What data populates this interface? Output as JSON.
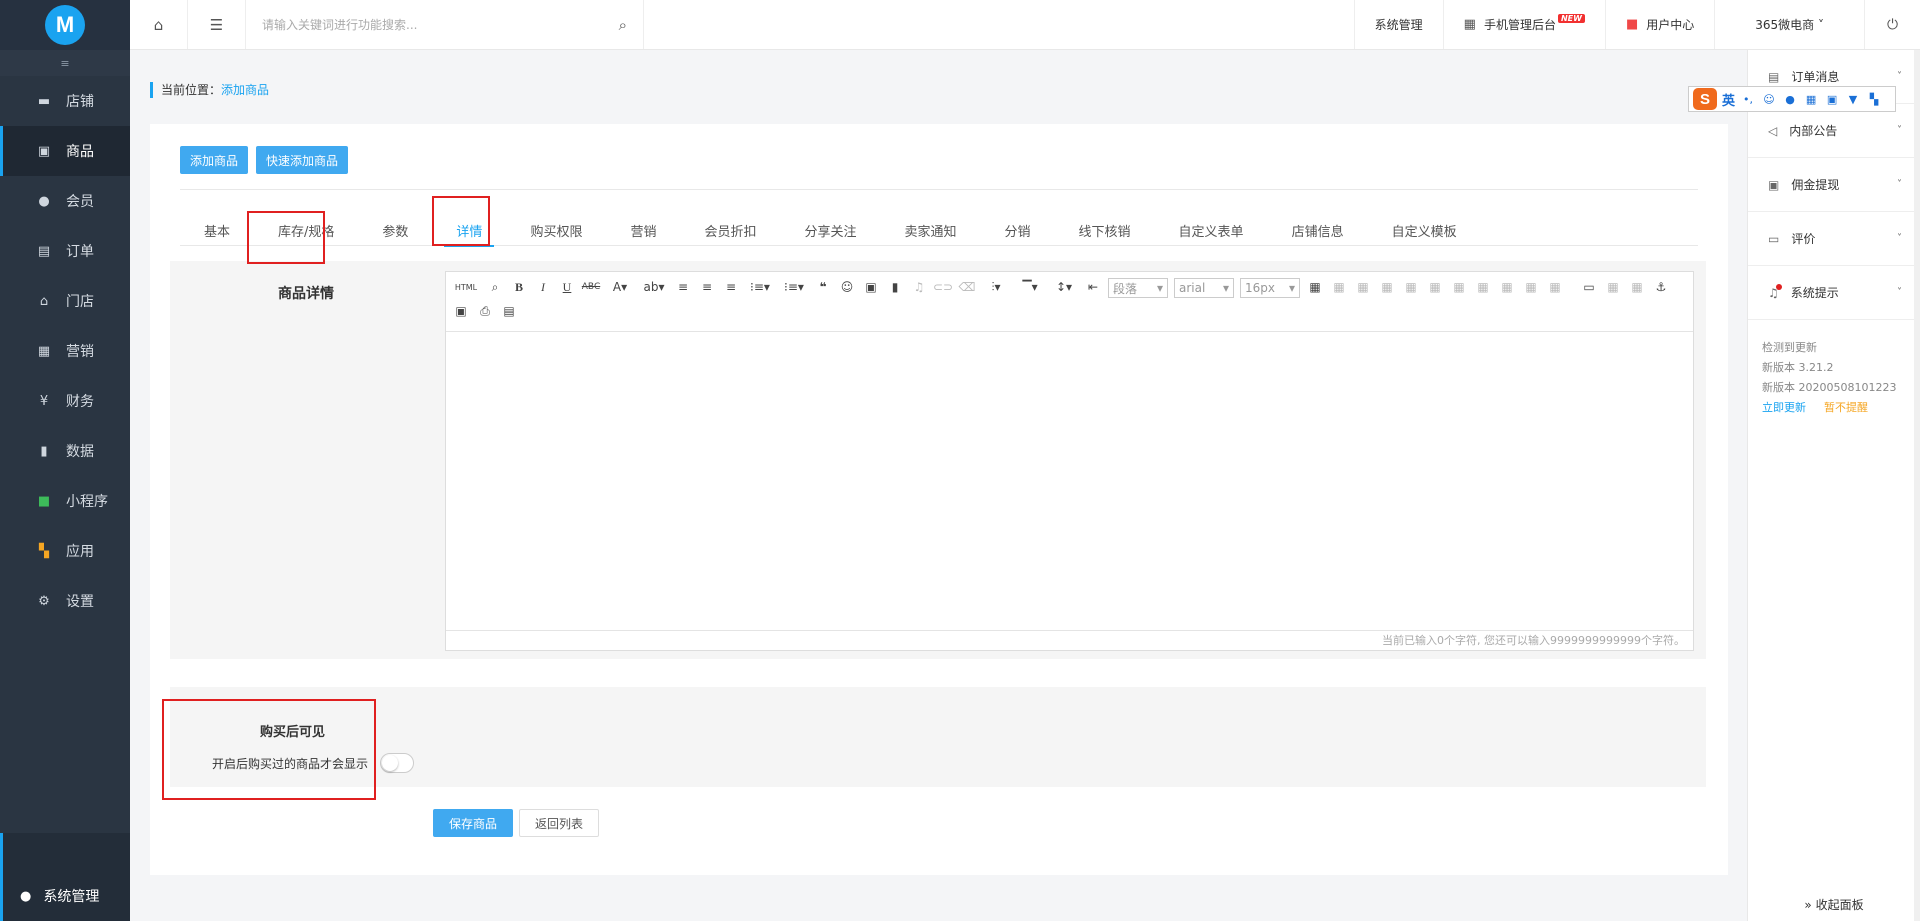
{
  "sidebar": {
    "logo_text": "M",
    "collapse_icon": "≡",
    "items": [
      {
        "label": "店铺",
        "icon": "store-icon"
      },
      {
        "label": "商品",
        "icon": "goods-icon"
      },
      {
        "label": "会员",
        "icon": "member-icon"
      },
      {
        "label": "订单",
        "icon": "order-icon"
      },
      {
        "label": "门店",
        "icon": "shop-icon"
      },
      {
        "label": "营销",
        "icon": "gift-icon"
      },
      {
        "label": "财务",
        "icon": "money-bag-icon"
      },
      {
        "label": "数据",
        "icon": "chart-icon"
      },
      {
        "label": "小程序",
        "icon": "miniapp-icon"
      },
      {
        "label": "应用",
        "icon": "apps-icon"
      },
      {
        "label": "设置",
        "icon": "gear-icon"
      }
    ],
    "active_index": 1,
    "bottom": {
      "label": "系统管理",
      "icon": "user-admin-icon"
    }
  },
  "header": {
    "search_placeholder": "请输入关键词进行功能搜索...",
    "links": {
      "system": "系统管理",
      "mobile": "手机管理后台",
      "new_badge": "NEW",
      "user_center": "用户中心",
      "shop_name": "365微电商 ˅"
    }
  },
  "breadcrumb": {
    "prefix": "当前位置：",
    "current": "添加商品"
  },
  "buttons": {
    "add_goods": "添加商品",
    "quick_add": "快速添加商品",
    "save": "保存商品",
    "back": "返回列表"
  },
  "tabs": [
    "基本",
    "库存/规格",
    "参数",
    "详情",
    "购买权限",
    "营销",
    "会员折扣",
    "分享关注",
    "卖家通知",
    "分销",
    "线下核销",
    "自定义表单",
    "店铺信息",
    "自定义模板"
  ],
  "active_tab": 3,
  "detail": {
    "label": "商品详情",
    "editor": {
      "paragraph": "段落",
      "font": "arial",
      "size": "16px",
      "status": "当前已输入0个字符, 您还可以输入9999999999999个字符。"
    }
  },
  "buy_after": {
    "title": "购买后可见",
    "desc": "开启后购买过的商品才会显示",
    "enabled": false
  },
  "right_panel": {
    "items": [
      {
        "label": "订单消息",
        "icon": "clipboard-icon"
      },
      {
        "label": "内部公告",
        "icon": "speaker-icon"
      },
      {
        "label": "佣金提现",
        "icon": "withdraw-icon"
      },
      {
        "label": "评价",
        "icon": "comment-icon"
      },
      {
        "label": "系统提示",
        "icon": "bell-icon"
      }
    ],
    "update": {
      "line1": "检测到更新",
      "line2": "新版本 3.21.2",
      "line3": "新版本 20200508101223",
      "update_now": "立即更新",
      "later": "暂不提醒"
    },
    "collapse": "» 收起面板"
  },
  "ime": {
    "lang": "英"
  }
}
